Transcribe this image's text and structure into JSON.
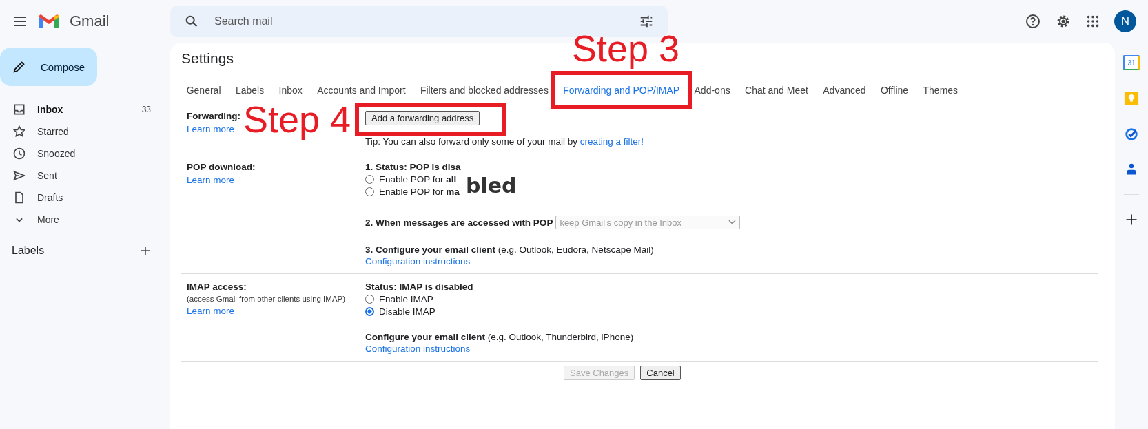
{
  "header": {
    "app_name": "Gmail",
    "search": {
      "placeholder": "Search mail"
    },
    "avatar": "N"
  },
  "sidebar": {
    "compose": "Compose",
    "items": [
      {
        "label": "Inbox",
        "count": "33",
        "unread": true
      },
      {
        "label": "Starred",
        "unread": false
      },
      {
        "label": "Snoozed",
        "unread": false
      },
      {
        "label": "Sent",
        "unread": false
      },
      {
        "label": "Drafts",
        "unread": false
      },
      {
        "label": "More",
        "unread": false
      }
    ],
    "labels_heading": "Labels"
  },
  "settings": {
    "title": "Settings",
    "tabs": [
      {
        "label": "General",
        "selected": false
      },
      {
        "label": "Labels",
        "selected": false
      },
      {
        "label": "Inbox",
        "selected": false
      },
      {
        "label": "Accounts and Import",
        "selected": false
      },
      {
        "label": "Filters and blocked addresses",
        "selected": false
      },
      {
        "label": "Forwarding and POP/IMAP",
        "selected": true
      },
      {
        "label": "Add-ons",
        "selected": false
      },
      {
        "label": "Chat and Meet",
        "selected": false
      },
      {
        "label": "Advanced",
        "selected": false
      },
      {
        "label": "Offline",
        "selected": false
      },
      {
        "label": "Themes",
        "selected": false
      }
    ],
    "forwarding": {
      "label": "Forwarding:",
      "learn_more": "Learn more",
      "button": "Add a forwarding address",
      "tip": "Tip: You can also forward only some of your mail by",
      "tip_link": "creating a filter!"
    },
    "pop": {
      "label": "POP download:",
      "learn_more": "Learn more",
      "status": "1. Status: POP is disa",
      "options": [
        {
          "text": "Enable POP for **all**",
          "selected": false
        },
        {
          "text": "Enable POP for **ma**",
          "selected": false
        }
      ],
      "when_label": "2. When messages are accessed with POP",
      "when_select": {
        "value": "keep Gmail's copy in the Inbox",
        "disabled": true
      },
      "configure": "**3. Configure your email client** (e.g. Outlook, Eudora, Netscape Mail)",
      "instructions": "Configuration instructions"
    },
    "imap": {
      "label": "IMAP access:",
      "note": "(access Gmail from other clients using IMAP)",
      "learn_more": "Learn more",
      "status": "Status: IMAP is disabled",
      "options": [
        {
          "text": "Enable IMAP",
          "selected": false
        },
        {
          "text": "Disable IMAP",
          "selected": true
        }
      ],
      "configure": "**Configure your email client** (e.g. Outlook, Thunderbird, iPhone)",
      "instructions": "Configuration instructions"
    },
    "buttons": [
      {
        "label": "Save Changes",
        "disabled": true
      },
      {
        "label": "Cancel",
        "disabled": false
      }
    ]
  },
  "side_panel": {
    "calendar_day": "31"
  },
  "overlay_fragment": "bled",
  "annotations": [
    {
      "text": "Step 3"
    },
    {
      "text": "Step 4"
    }
  ]
}
